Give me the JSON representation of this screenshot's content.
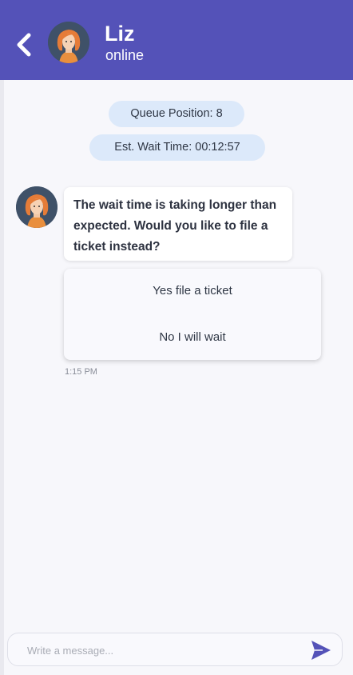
{
  "header": {
    "agent_name": "Liz",
    "agent_status": "online",
    "background_color": "#5452b8"
  },
  "queue": {
    "position_text": "Queue Position: 8",
    "wait_text": "Est. Wait Time: 00:12:57"
  },
  "message": {
    "text": "The wait time is taking longer than expected. Would you like to file a ticket instead?",
    "time": "1:15 PM",
    "options": [
      {
        "label": "Yes file a ticket"
      },
      {
        "label": "No I will wait"
      }
    ]
  },
  "composer": {
    "placeholder": "Write a message...",
    "send_icon": "send-icon",
    "accent_color": "#5452b8"
  }
}
